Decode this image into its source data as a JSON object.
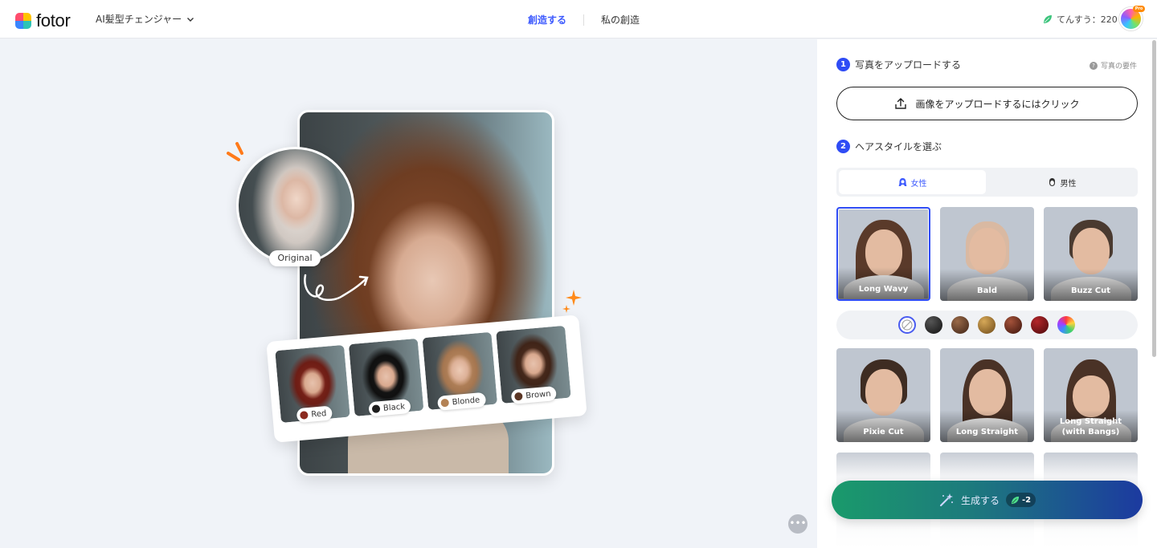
{
  "header": {
    "logo_text": "fotor",
    "tool_name": "AI髪型チェンジャー",
    "nav_tabs": [
      {
        "label": "創造する",
        "active": true
      },
      {
        "label": "私の創造",
        "active": false
      }
    ],
    "credits_text": "てんすう：220",
    "pro_badge": "Pro"
  },
  "preview": {
    "original_label": "Original",
    "color_examples": [
      {
        "label": "Red",
        "color": "#8b2a1f"
      },
      {
        "label": "Black",
        "color": "#1c1c1c"
      },
      {
        "label": "Blonde",
        "color": "#b38255"
      },
      {
        "label": "Brown",
        "color": "#5a3524"
      }
    ]
  },
  "panel": {
    "step1": {
      "number": "1",
      "title": "写真をアップロードする"
    },
    "requirements_link": "写真の要件",
    "upload_button": "画像をアップロードするにはクリック",
    "step2": {
      "number": "2",
      "title": "ヘアスタイルを選ぶ"
    },
    "gender_tabs": [
      {
        "label": "女性",
        "active": true
      },
      {
        "label": "男性",
        "active": false
      }
    ],
    "hairstyles": [
      {
        "label": "Long Wavy",
        "selected": true
      },
      {
        "label": "Bald",
        "selected": false
      },
      {
        "label": "Buzz Cut",
        "selected": false
      },
      {
        "label": "Pixie Cut",
        "selected": false
      },
      {
        "label": "Long Straight",
        "selected": false
      },
      {
        "label": "Long Straight (with Bangs)",
        "selected": false
      }
    ],
    "hair_colors": [
      "none",
      "#1e1e1e",
      "#5b3a26",
      "#a0722e",
      "#6b2a1c",
      "#7a1416",
      "rainbow"
    ],
    "generate_button": "生成する",
    "generate_cost": "-2"
  },
  "colors": {
    "accent": "#3d5afe",
    "step_badge": "#2f4cf5",
    "generate_gradient_start": "#1a9a6b",
    "generate_gradient_end": "#1c3aa0"
  }
}
